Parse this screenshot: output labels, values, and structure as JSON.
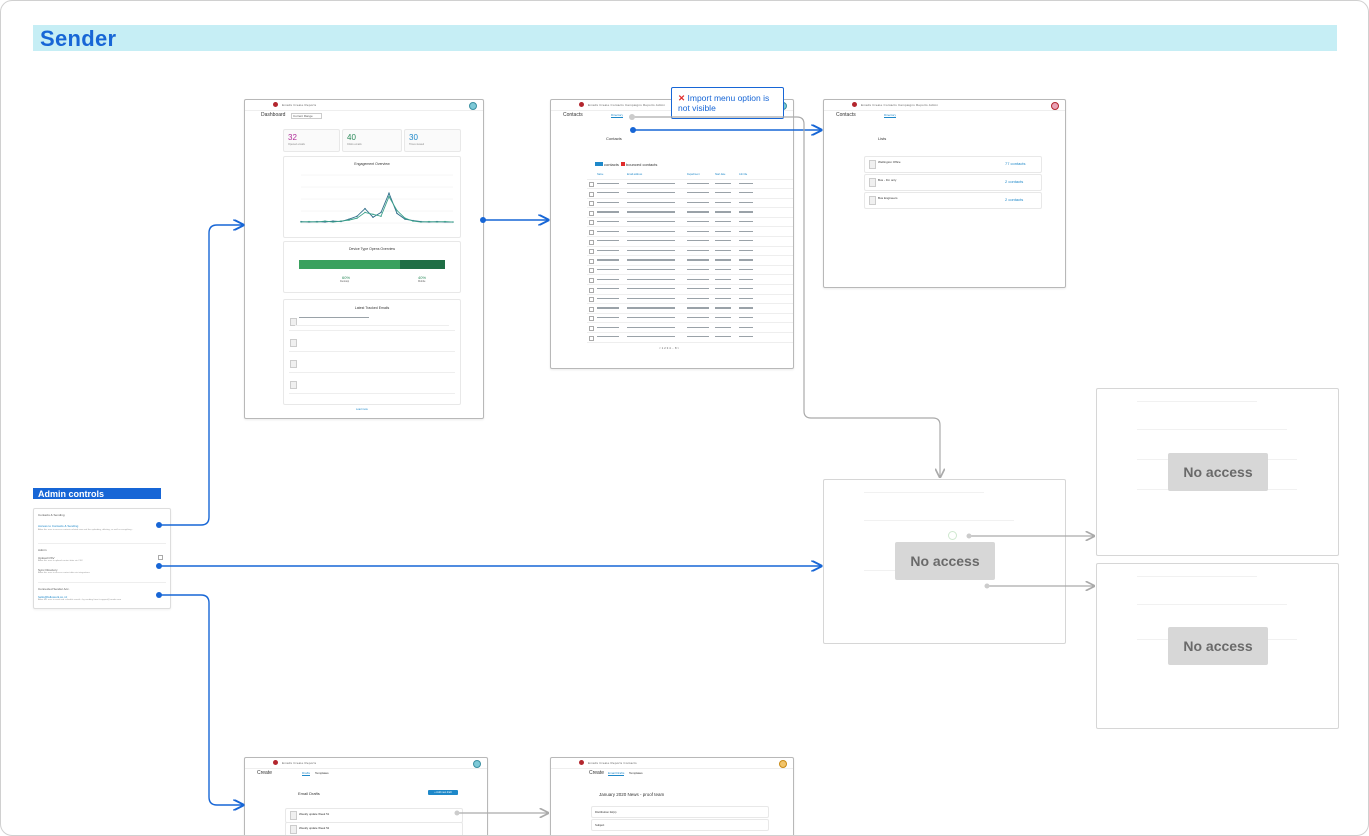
{
  "banner": {
    "title": "Sender"
  },
  "callout": {
    "icon": "x-icon",
    "text": "Import menu option is not visible"
  },
  "no_access": {
    "label": "No access"
  },
  "admin": {
    "header": "Admin controls",
    "section1": "Contacts & Sending",
    "link1": "Access to Contacts & Sending",
    "desc1": "Allow this user to access contacts related view and the uploading, deleting, as well as everything...",
    "section2": "Admin",
    "item2a": "Upload CSV",
    "desc2a": "Allow this user to upload contact data via CSV",
    "item2b": "Sync Directory",
    "desc2b": "Allow this user to access contact data via integrations",
    "section3": "Connected Sender Acc.",
    "link3": "hello@fellowork.co.nz",
    "desc3": "Allow this user to send and schedule emails - by sending from it.support@sender.com"
  },
  "dashboard": {
    "nav": "Emails  Create  Reports",
    "title": "Dashboard",
    "filter": "Current Range",
    "stats": [
      {
        "value": "32",
        "label": "Opened emails",
        "color": "#b0309a"
      },
      {
        "value": "40",
        "label": "Clicks emails",
        "color": "#2a8a5a"
      },
      {
        "value": "30",
        "label": "Times viewed",
        "color": "#1e88c9"
      }
    ],
    "engagement_title": "Engagement Overview",
    "device_title": "Device Type Opens Overview",
    "device": [
      {
        "pct": "60%",
        "label": "Desktop"
      },
      {
        "pct": "40%",
        "label": "Mobile"
      }
    ],
    "latest_title": "Latest Tracked Emails",
    "load_more": "Load more"
  },
  "chart_data": {
    "type": "line",
    "title": "Engagement Overview",
    "xlabel": "",
    "ylabel": "",
    "categories": [
      "1",
      "2",
      "3",
      "4",
      "5",
      "6",
      "7",
      "8",
      "9",
      "10",
      "11",
      "12",
      "13",
      "14",
      "15",
      "16",
      "17",
      "18",
      "19",
      "20"
    ],
    "series": [
      {
        "values": [
          3,
          2,
          3,
          2,
          4,
          3,
          8,
          14,
          30,
          12,
          22,
          62,
          20,
          8,
          5,
          3,
          2,
          3,
          2,
          2
        ]
      },
      {
        "values": [
          2,
          3,
          2,
          4,
          2,
          4,
          6,
          10,
          22,
          18,
          14,
          55,
          26,
          10,
          4,
          2,
          3,
          2,
          3,
          2
        ]
      }
    ],
    "ylim": [
      0,
      100
    ]
  },
  "contacts": {
    "nav": "Emails  Create  Contacts  Campaigns  Reports  Admin",
    "title": "Contacts",
    "tab": "Directory",
    "heading": "Contacts",
    "count_label": "contacts",
    "bounced_label": "bounced contacts",
    "columns": [
      "Name",
      "Email address",
      "Department",
      "Start date",
      "Job title"
    ],
    "rows": 17,
    "pagination": "< 1 2 3 4 ... 8 >"
  },
  "lists": {
    "nav": "Emails  Create  Contacts  Campaigns  Reports  Admin",
    "title": "Contacts",
    "tab": "Directory",
    "heading": "Lists",
    "items": [
      {
        "name": "Wellington Office",
        "count": "77 contacts"
      },
      {
        "name": "Bus - Fin only",
        "count": "2 contacts"
      },
      {
        "name": "Bus Engineers",
        "count": "2 contacts"
      }
    ]
  },
  "create": {
    "nav": "Emails  Create  Reports",
    "title": "Create",
    "tabs": [
      "Drafts",
      "Templates"
    ],
    "heading": "Email Drafts",
    "button": "+ Add new draft",
    "drafts": [
      "Weekly update Week 51",
      "Weekly update Week 52"
    ]
  },
  "draft_edit": {
    "nav": "Emails  Create  Reports  Contacts",
    "title": "Create",
    "tabs": [
      "Email Drafts",
      "Templates"
    ],
    "heading": "January 2020 News - proof team",
    "fields": [
      "Distribution list(s)",
      "Subject"
    ]
  },
  "colors": {
    "accent": "#1766d6",
    "banner": "#c6eef5",
    "noaccess": "#d7d7d7"
  }
}
